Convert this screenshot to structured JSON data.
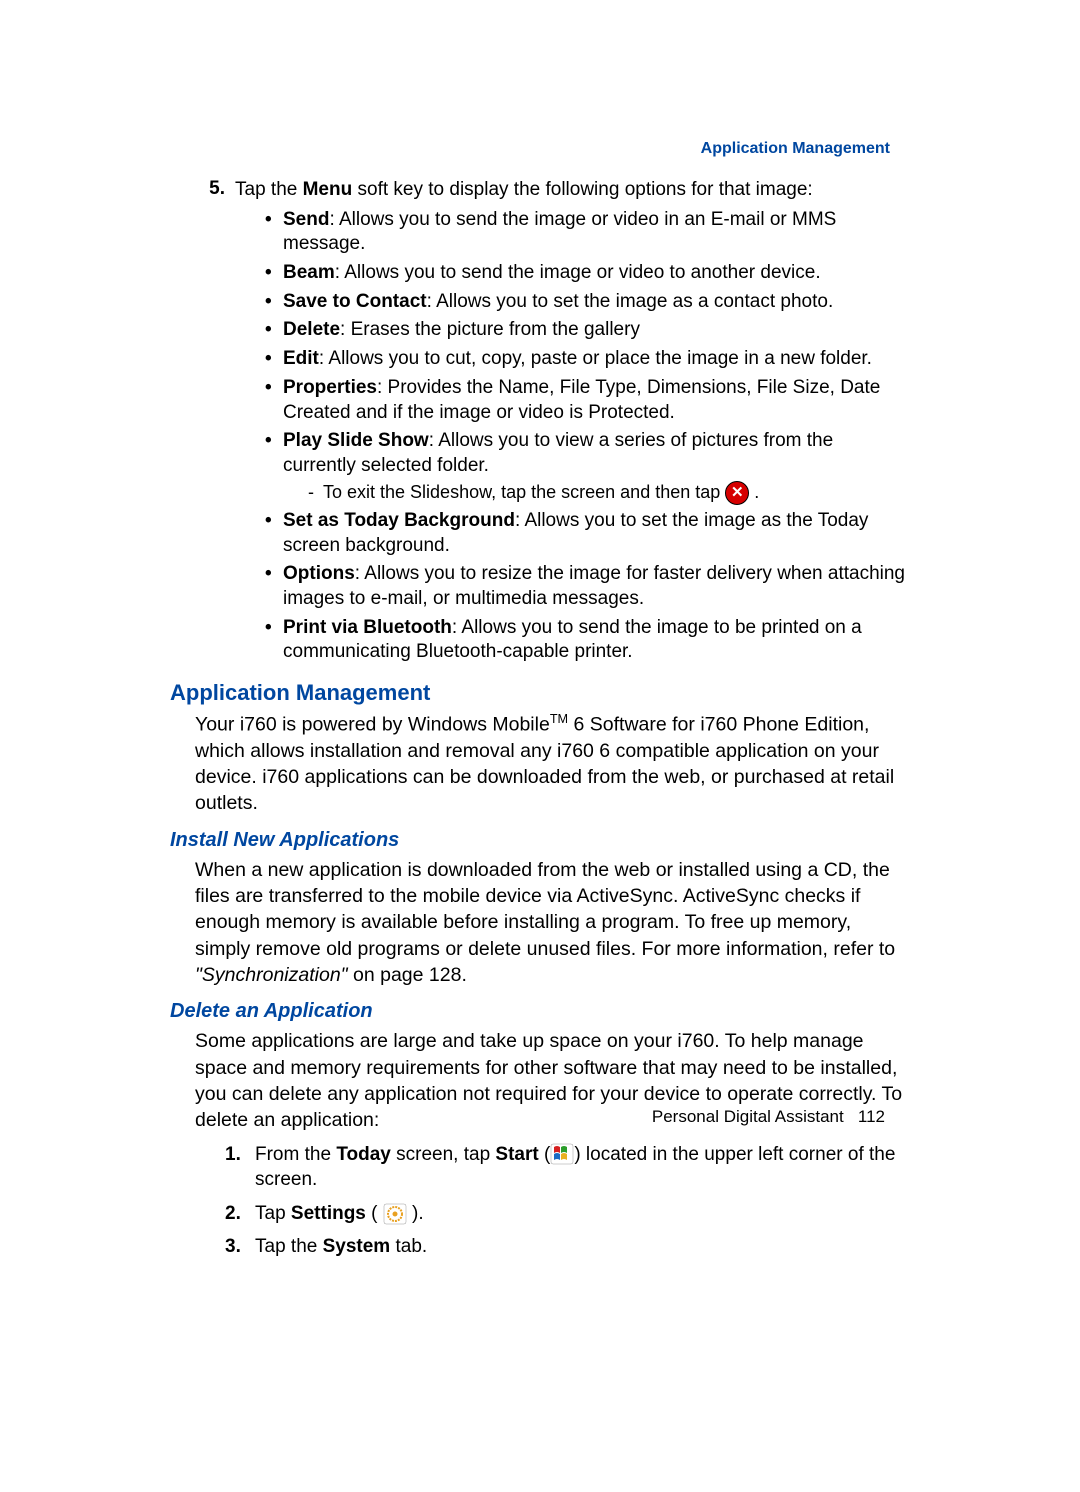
{
  "header": {
    "title": "Application Management"
  },
  "step5": {
    "number": "5.",
    "text_pre": "Tap the ",
    "text_bold": "Menu",
    "text_post": " soft key to display the following options for that image:"
  },
  "menu_options": [
    {
      "label": "Send",
      "desc": ": Allows you to send the image or video in an E-mail or MMS message."
    },
    {
      "label": "Beam",
      "desc": ": Allows you to send the image or video to another device."
    },
    {
      "label": "Save to Contact",
      "desc": ": Allows you to set the image as a contact photo."
    },
    {
      "label": "Delete",
      "desc": ": Erases the picture from the gallery"
    },
    {
      "label": "Edit",
      "desc": ": Allows you to cut, copy, paste or place the image in a new folder."
    },
    {
      "label": "Properties",
      "desc": ": Provides the Name, File Type, Dimensions, File Size, Date Created and if the image or video is Protected."
    },
    {
      "label": "Play Slide Show",
      "desc": ": Allows you to view a series of pictures from the currently selected folder.",
      "sub": "To exit the Slideshow, tap the screen and then tap "
    },
    {
      "label": "Set as Today Background",
      "desc": ": Allows you to set the image as the Today screen background."
    },
    {
      "label": "Options",
      "desc": ": Allows you to resize the image for faster delivery when attaching images to e-mail, or multimedia messages."
    },
    {
      "label": "Print via Bluetooth",
      "desc": ": Allows you to send the image to be printed on a communicating Bluetooth-capable printer."
    }
  ],
  "app_mgmt": {
    "heading": "Application Management",
    "body_pre": "Your i760 is powered by Windows Mobile",
    "body_tm": "TM",
    "body_post": " 6 Software for i760 Phone Edition, which allows installation and removal any i760 6 compatible application on your device. i760 applications can be downloaded from the web, or purchased at retail outlets."
  },
  "install": {
    "heading": "Install New Applications",
    "body": "When a new application is downloaded from the web or installed using a CD, the files are transferred to the mobile device via ActiveSync. ActiveSync checks if enough memory is available before installing a program. To free up memory, simply remove old programs or delete unused files. For more information, refer to ",
    "ref_italic": "\"Synchronization\"",
    "ref_post": "  on page 128."
  },
  "delete_app": {
    "heading": "Delete an Application",
    "body": "Some applications are large and take up space on your i760. To help manage space and memory requirements for other software that may need to be installed, you can delete any application not required for your device to operate correctly. To delete an application:",
    "steps": [
      {
        "num": "1.",
        "pre": "From the ",
        "b1": "Today",
        "mid1": " screen, tap ",
        "b2": "Start",
        "mid2": " (",
        "icon": "start",
        "post": ") located in the upper left corner of the screen."
      },
      {
        "num": "2.",
        "pre": "Tap ",
        "b1": "Settings",
        "mid1": " ( ",
        "icon": "settings",
        "post": " )."
      },
      {
        "num": "3.",
        "pre": "Tap the ",
        "b1": "System",
        "post": " tab."
      }
    ]
  },
  "footer": {
    "text": "Personal Digital Assistant",
    "page": "112"
  }
}
